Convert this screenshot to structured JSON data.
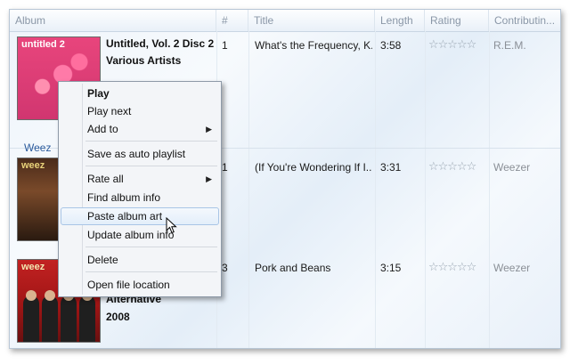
{
  "columns": [
    "Album",
    "#",
    "Title",
    "Length",
    "Rating",
    "Contributin..."
  ],
  "groups": [
    {
      "album_lines": [
        "Untitled, Vol. 2 Disc 2",
        "Various Artists"
      ],
      "art_text": "untitled 2",
      "track": {
        "number": "1",
        "title": "What's the Frequency, K...",
        "length": "3:58",
        "rating": "☆☆☆☆☆",
        "artist": "R.E.M."
      }
    },
    {
      "label": "Weez",
      "art_text": "weez",
      "track": {
        "number": "1",
        "title": "(If You're Wondering If I...",
        "length": "3:31",
        "rating": "☆☆☆☆☆",
        "artist": "Weezer"
      }
    },
    {
      "album_lines": [
        "Alternative",
        "2008"
      ],
      "art_text": "weez",
      "track": {
        "number": "3",
        "title": "Pork and Beans",
        "length": "3:15",
        "rating": "☆☆☆☆☆",
        "artist": "Weezer"
      }
    }
  ],
  "menu": {
    "items": [
      {
        "label": "Play",
        "bold": true
      },
      {
        "label": "Play next"
      },
      {
        "label": "Add to",
        "submenu": "▶"
      },
      {
        "label": "Save as auto playlist"
      },
      {
        "label": "Rate all",
        "submenu": "▶"
      },
      {
        "label": "Find album info"
      },
      {
        "label": "Paste album art",
        "highlighted": true
      },
      {
        "label": "Update album info"
      },
      {
        "label": "Delete"
      },
      {
        "label": "Open file location"
      }
    ]
  },
  "colors": {
    "accent": "#2a5a9c",
    "menu_highlight": "#a9c5e6"
  }
}
